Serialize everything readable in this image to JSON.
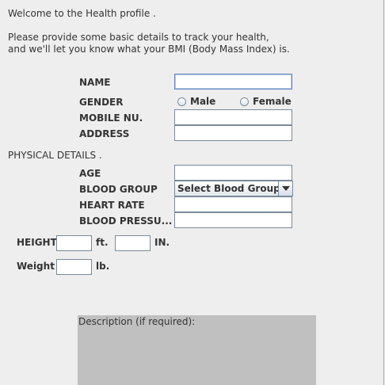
{
  "intro": {
    "welcome": "Welcome to the Health profile .",
    "line1": "Please provide some basic details to track your health,",
    "line2": "and we'll let you know what your BMI (Body Mass Index) is."
  },
  "personal": {
    "name_label": "NAME",
    "name_value": "",
    "gender_label": "GENDER",
    "gender_options": [
      "Male",
      "Female"
    ],
    "mobile_label": "MOBILE NU.",
    "mobile_value": "",
    "address_label": "ADDRESS",
    "address_value": ""
  },
  "physical": {
    "section_title": "PHYSICAL DETAILS .",
    "age_label": "AGE",
    "age_value": "",
    "blood_group_label": "BLOOD GROUP",
    "blood_group_selected": "Select Blood Group",
    "heart_rate_label": "HEART RATE",
    "heart_rate_value": "",
    "blood_pressure_label": "BLOOD PRESSU...",
    "blood_pressure_value": ""
  },
  "measurements": {
    "height_label": "HEIGHT",
    "feet_value": "",
    "feet_unit": "ft.",
    "inches_value": "",
    "inches_unit": "IN.",
    "weight_label": "Weight",
    "weight_value": "",
    "weight_unit": "lb."
  },
  "description": {
    "title": "Description (if required):",
    "value": ""
  },
  "icons": {
    "dropdown": "chevron-down-icon"
  },
  "colors": {
    "background": "#eeeeee",
    "text": "#333333",
    "field_border": "#7a8a99",
    "description_bg": "#c0c0c0"
  }
}
